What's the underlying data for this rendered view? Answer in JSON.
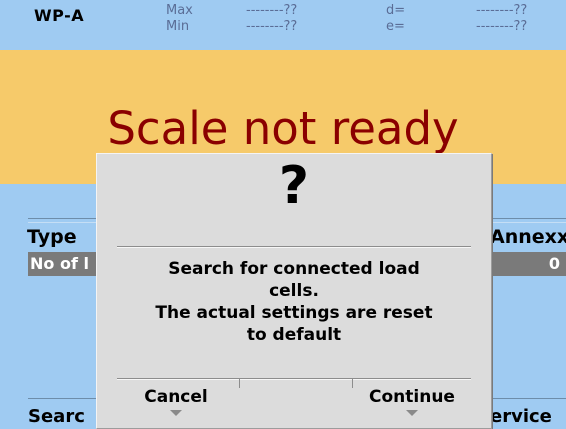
{
  "header": {
    "device": "WP-A",
    "max_label": "Max",
    "min_label": "Min",
    "max_value": "--------??",
    "min_value": "--------??",
    "d_label": "d=",
    "e_label": "e=",
    "d_value": "--------??",
    "e_value": "--------??"
  },
  "status": {
    "text": "Scale not ready"
  },
  "screen": {
    "type_label": "Type",
    "right_header": "Annexx",
    "row_label": "No of l",
    "row_value": "0",
    "bottom_left": "Searc",
    "bottom_right": "ervice"
  },
  "dialog": {
    "icon": "?",
    "message": [
      "Search for connected load",
      "cells.",
      "The actual settings are reset",
      "to default"
    ],
    "buttons": {
      "cancel": "Cancel",
      "continue": "Continue"
    }
  },
  "colors": {
    "background": "#9fcbf2",
    "status_band": "#f6ca6a",
    "status_text": "#8a0000",
    "dialog": "#dcdcdc"
  }
}
